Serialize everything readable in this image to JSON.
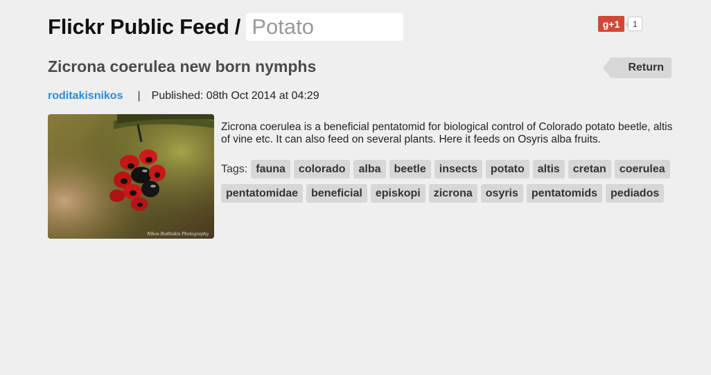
{
  "header": {
    "title": "Flickr Public Feed",
    "separator": "/",
    "search": {
      "value": "Potato",
      "placeholder": ""
    }
  },
  "social": {
    "button_label": "g+1",
    "count": "1",
    "brand_color": "#d14836"
  },
  "post": {
    "title": "Zicrona coerulea new born nymphs",
    "return_label": "Return",
    "author": "roditakisnikos",
    "meta_separator": "|",
    "published": "Published: 08th Oct 2014 at 04:29",
    "photo_watermark": "Nikos Roditakis Photography",
    "description": "Zicrona coerulea is a beneficial pentatomid for biological control of Colorado potato beetle, altis of vine etc. It can also feed on several plants. Here it feeds on Osyris alba fruits.",
    "tags_label": "Tags:",
    "tags": [
      "fauna",
      "colorado",
      "alba",
      "beetle",
      "insects",
      "potato",
      "altis",
      "cretan",
      "coerulea",
      "pentatomidae",
      "beneficial",
      "episkopi",
      "zicrona",
      "osyris",
      "pentatomids",
      "pediados"
    ]
  },
  "colors": {
    "background": "#efefef",
    "link": "#2a8ad6",
    "tag_bg": "#d7d7d7"
  }
}
